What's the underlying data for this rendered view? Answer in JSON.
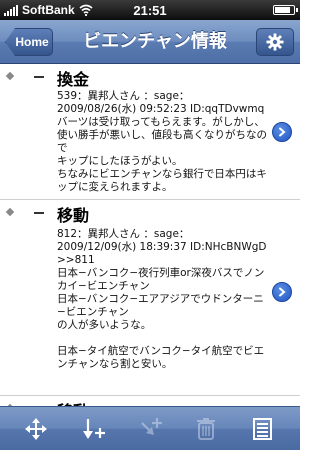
{
  "status": {
    "carrier": "SoftBank",
    "time": "21:51",
    "battery_level": 0.85
  },
  "nav": {
    "back_label": "Home",
    "title": "ビエンチャン情報"
  },
  "posts": [
    {
      "title": "換金",
      "body": "539：異邦人さん ：sage：\n2009/08/26(水) 09:52:23 ID:qqTDvwmq\nバーツは受け取ってもらえます。がしかし、使い勝手が悪いし、値段も高くなりがちなので\nキップにしたほうがよい。\nちなみにビエンチャンなら銀行で日本円はキップに変えられますよ。"
    },
    {
      "title": "移動",
      "body": "812：異邦人さん ：sage：\n2009/12/09(水) 18:39:37 ID:NHcBNWgD\n>>811\n日本−バンコク−夜行列車or深夜バスでノンカイ−ビエンチャン\n日本−バンコク−エアアジアでウドンターニ−ビエンチャン\nの人が多いような。\n\n日本−タイ航空でバンコク−タイ航空でビエンチャンなら割と安い。"
    },
    {
      "title": "移動",
      "body": ""
    }
  ],
  "colors": {
    "navbar": "#5b7cb2",
    "disclosure": "#1f56c7"
  },
  "icons": {
    "back": "chevron-left",
    "settings": "gear-icon",
    "move": "move-arrows-icon",
    "add_below": "add-below-icon",
    "add_above": "add-above-icon",
    "trash": "trash-icon",
    "list": "list-icon"
  }
}
